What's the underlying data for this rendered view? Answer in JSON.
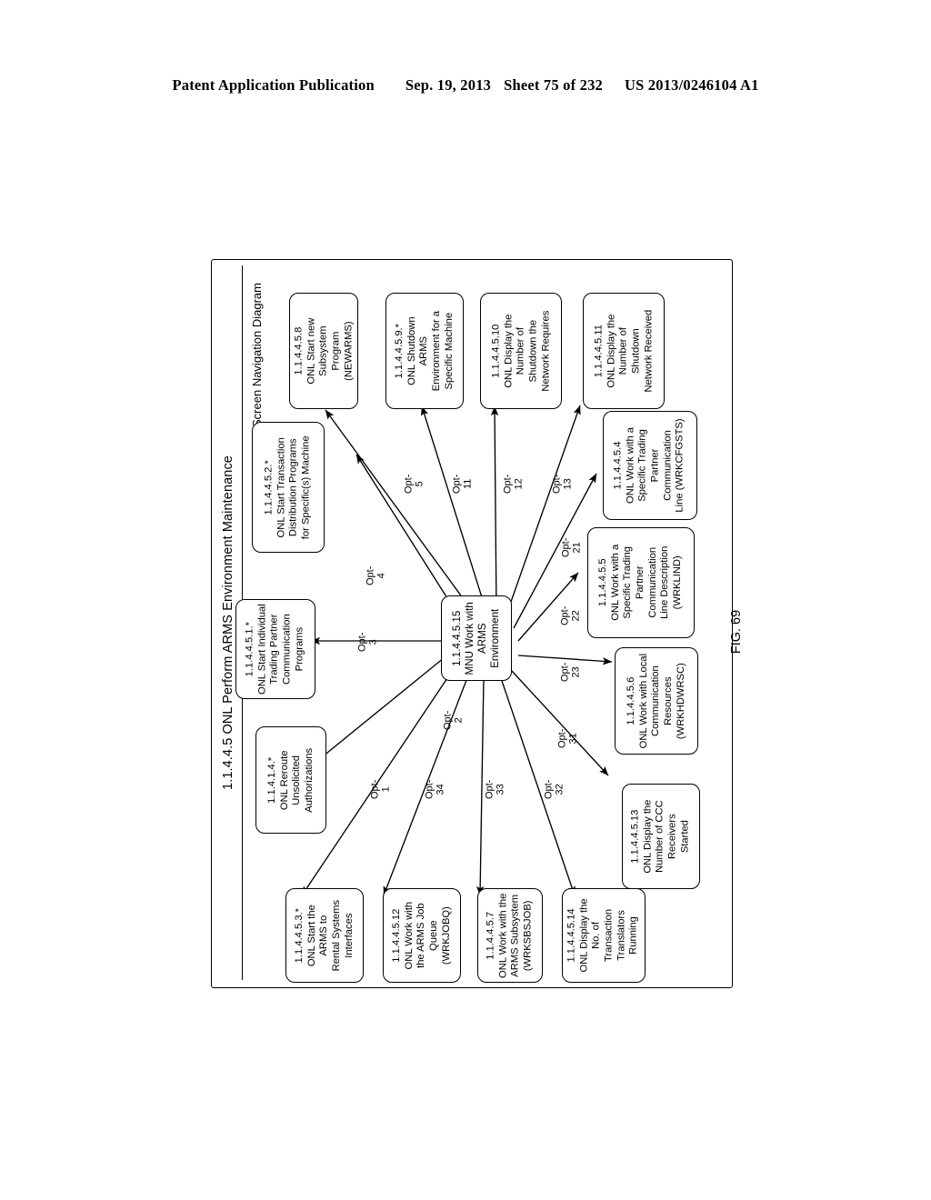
{
  "header": {
    "publication": "Patent Application Publication",
    "date": "Sep. 19, 2013",
    "sheet": "Sheet 75 of 232",
    "patent_number": "US 2013/0246104 A1"
  },
  "figure": {
    "caption": "FIG. 69",
    "title": "1.1.4.4.5 ONL Perform ARMS Environment Maintenance",
    "subtitle": "Screen Navigation Diagram"
  },
  "hub": {
    "id": "1.1.4.4.5.15",
    "line1": "1.1.4.4.5.15",
    "line2": "MNU Work with",
    "line3": "ARMS",
    "line4": "Environment"
  },
  "nodes": [
    {
      "name": "node-1-1-4-1-4",
      "lines": [
        "1.1.4.1.4.*",
        "ONL Reroute",
        "Unsolicited",
        "Authorizations"
      ]
    },
    {
      "name": "node-1-1-4-4-5-1",
      "lines": [
        "1.1.4.4.5.1.*",
        "ONL Start Individual",
        "Trading Partner",
        "Communication",
        "Programs"
      ]
    },
    {
      "name": "node-1-1-4-4-5-2",
      "lines": [
        "1.1.4.4.5.2.*",
        "ONL Start Transaction",
        "Distribution Programs",
        "for Specific(s) Machine"
      ]
    },
    {
      "name": "node-1-1-4-4-5-8",
      "lines": [
        "1.1.4.4.5.8",
        "ONL Start new",
        "Subsystem",
        "Program",
        "(NEWARMS)"
      ]
    },
    {
      "name": "node-1-1-4-4-5-9",
      "lines": [
        "1.1.4.4.5.9.*",
        "ONL Shutdown",
        "ARMS",
        "Environment for a",
        "Specific Machine"
      ]
    },
    {
      "name": "node-1-1-4-4-5-10",
      "lines": [
        "1.1.4.4.5.10",
        "ONL Display the",
        "Number of",
        "Shutdown the",
        "Network Requires"
      ]
    },
    {
      "name": "node-1-1-4-4-5-11",
      "lines": [
        "1.1.4.4.5.11",
        "ONL Display the",
        "Number of",
        "Shutdown",
        "Network Received"
      ]
    },
    {
      "name": "node-1-1-4-4-5-4",
      "lines": [
        "1.1.4.4.5.4",
        "ONL Work with a",
        "Specific Trading",
        "Partner",
        "Communication",
        "Line (WRKCFGSTS)"
      ]
    },
    {
      "name": "node-1-1-4-4-5-5",
      "lines": [
        "1.1.4.4.5.5",
        "ONL Work with a",
        "Specific Trading",
        "Partner",
        "Communication",
        "Line Description",
        "(WRKLIND)"
      ]
    },
    {
      "name": "node-1-1-4-4-5-6",
      "lines": [
        "1.1.4.4.5.6",
        "ONL Work with Local",
        "Communication",
        "Resources",
        "(WRKHDWRSC)"
      ]
    },
    {
      "name": "node-1-1-4-4-5-13",
      "lines": [
        "1.1.4.4.5.13",
        "ONL Display the",
        "Number of CCC",
        "Receivers",
        "Started"
      ]
    },
    {
      "name": "node-1-1-4-4-5-3",
      "lines": [
        "1.1.4.4.5.3.*",
        "ONL Start the",
        "ARMS to",
        "Rental Systems",
        "Interfaces"
      ]
    },
    {
      "name": "node-1-1-4-4-5-12",
      "lines": [
        "1.1.4.4.5.12",
        "ONL Work with",
        "the ARMS Job",
        "Queue",
        "(WRKJOBQ)"
      ]
    },
    {
      "name": "node-1-1-4-4-5-7",
      "lines": [
        "1.1.4.4.5.7",
        "ONL Work with the",
        "ARMS Subsystem",
        "(WRKSBSJOB)"
      ]
    },
    {
      "name": "node-1-1-4-4-5-14",
      "lines": [
        "1.1.4.4.5.14",
        "ONL Display the",
        "No. of",
        "Transaction",
        "Translators",
        "Running"
      ]
    }
  ],
  "options": [
    {
      "name": "opt-1",
      "top": "Opt-",
      "num": "1"
    },
    {
      "name": "opt-2",
      "top": "Opt-",
      "num": "2"
    },
    {
      "name": "opt-3",
      "top": "Opt-",
      "num": "3"
    },
    {
      "name": "opt-4",
      "top": "Opt-",
      "num": "4"
    },
    {
      "name": "opt-5",
      "top": "Opt-",
      "num": "5"
    },
    {
      "name": "opt-11",
      "top": "Opt-",
      "num": "11"
    },
    {
      "name": "opt-12",
      "top": "Opt-",
      "num": "12"
    },
    {
      "name": "opt-13",
      "top": "Opt-",
      "num": "13"
    },
    {
      "name": "opt-21",
      "top": "Opt-",
      "num": "21"
    },
    {
      "name": "opt-22",
      "top": "Opt-",
      "num": "22"
    },
    {
      "name": "opt-23",
      "top": "Opt-",
      "num": "23"
    },
    {
      "name": "opt-31",
      "top": "Opt-",
      "num": "31"
    },
    {
      "name": "opt-32",
      "top": "Opt-",
      "num": "32"
    },
    {
      "name": "opt-33",
      "top": "Opt-",
      "num": "33"
    },
    {
      "name": "opt-34",
      "top": "Opt-",
      "num": "34"
    }
  ],
  "colors": {
    "ink": "#000000",
    "paper": "#ffffff"
  }
}
